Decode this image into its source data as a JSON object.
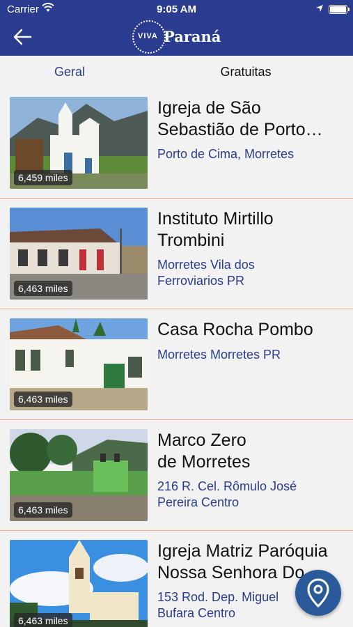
{
  "status_bar": {
    "carrier": "Carrier",
    "time": "9:05 AM"
  },
  "header": {
    "logo_small": "VIVA",
    "logo_main": "Paraná"
  },
  "tabs": [
    {
      "label": "Geral",
      "selected": true
    },
    {
      "label": "Gratuitas",
      "selected": false
    }
  ],
  "items": [
    {
      "title": "Igreja de São\nSebastião de Porto…",
      "address": "Porto de Cima, Morretes",
      "distance": "6,459 miles"
    },
    {
      "title": "Instituto Mirtillo\nTrombini",
      "address": "Morretes Vila dos\nFerroviarios PR",
      "distance": "6,463 miles"
    },
    {
      "title": "Casa Rocha Pombo",
      "address": "Morretes Morretes PR",
      "distance": "6,463 miles"
    },
    {
      "title": "Marco Zero\nde Morretes",
      "address": "216 R. Cel. Rômulo José\nPereira Centro",
      "distance": "6,463 miles"
    },
    {
      "title": "Igreja Matriz Paróquia\nNossa Senhora Do…",
      "address": "153 Rod. Dep. Miguel\nBufara Centro",
      "distance": "6,463 miles"
    }
  ],
  "icons": {
    "back": "back-arrow-icon",
    "wifi": "wifi-icon",
    "location": "location-arrow-icon",
    "battery": "battery-icon",
    "map": "map-pin-icon"
  },
  "colors": {
    "brand": "#2a3c8f",
    "accent_link": "#2a3c8f",
    "divider": "#f0a58a",
    "fab": "#2a5a9a"
  }
}
